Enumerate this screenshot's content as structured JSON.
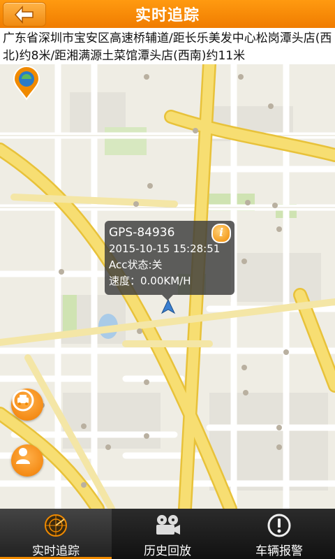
{
  "header": {
    "title": "实时追踪",
    "back_icon": "back-arrow-icon"
  },
  "address": {
    "text": "广东省深圳市宝安区高速桥辅道/距长乐美发中心松岗潭头店(西北)约8米/距湘满源土菜馆潭头店(西南)约11米"
  },
  "popup": {
    "plate": "GPS-84936",
    "time": "2015-10-15 15:28:51",
    "acc": "Acc状态:关",
    "speed": "速度：0.00KM/H",
    "info_icon": "i"
  },
  "map_controls": {
    "nearby_car_icon": "car-locate-icon",
    "person_locate_icon": "person-locate-icon"
  },
  "tabs": [
    {
      "label": "实时追踪",
      "icon": "radar-icon",
      "active": true
    },
    {
      "label": "历史回放",
      "icon": "film-reel-icon",
      "active": false
    },
    {
      "label": "车辆报警",
      "icon": "alert-icon",
      "active": false
    }
  ],
  "colors": {
    "accent": "#f08a00",
    "road_major": "#f5d85b",
    "road_minor": "#ffffff",
    "tabbar": "#1a1a1a"
  }
}
